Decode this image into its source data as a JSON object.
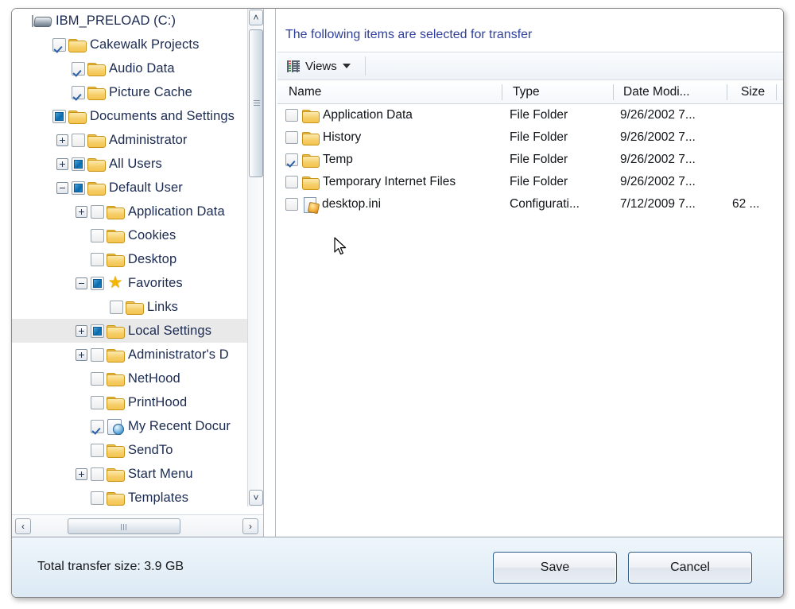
{
  "caption": "The following items are selected for transfer",
  "toolbar": {
    "views_label": "Views",
    "views_icon": "views-list-icon",
    "caret_icon": "chevron-down-icon"
  },
  "tree": {
    "root_label": "IBM_PRELOAD (C:)",
    "root_icon": "drive-icon",
    "items": [
      {
        "label": "IBM_PRELOAD (C:)",
        "depth": 0,
        "icon": "drive-icon",
        "check": "none",
        "expander": "none",
        "selected": false
      },
      {
        "label": "Cakewalk Projects",
        "depth": 1,
        "icon": "folder-icon",
        "check": "checked",
        "expander": "none",
        "selected": false
      },
      {
        "label": "Audio Data",
        "depth": 2,
        "icon": "folder-icon",
        "check": "checked",
        "expander": "none",
        "selected": false
      },
      {
        "label": "Picture Cache",
        "depth": 2,
        "icon": "folder-icon",
        "check": "checked",
        "expander": "none",
        "selected": false
      },
      {
        "label": "Documents and Settings",
        "depth": 1,
        "icon": "folder-icon",
        "check": "partial",
        "expander": "none",
        "selected": false
      },
      {
        "label": "Administrator",
        "depth": 2,
        "icon": "folder-icon",
        "check": "unchecked",
        "expander": "plus",
        "selected": false
      },
      {
        "label": "All Users",
        "depth": 2,
        "icon": "folder-icon",
        "check": "partial",
        "expander": "plus",
        "selected": false
      },
      {
        "label": "Default User",
        "depth": 2,
        "icon": "folder-icon",
        "check": "partial",
        "expander": "minus",
        "selected": false
      },
      {
        "label": "Application Data",
        "depth": 3,
        "icon": "folder-icon",
        "check": "unchecked",
        "expander": "plus",
        "selected": false
      },
      {
        "label": "Cookies",
        "depth": 3,
        "icon": "folder-icon",
        "check": "unchecked",
        "expander": "none",
        "selected": false
      },
      {
        "label": "Desktop",
        "depth": 3,
        "icon": "folder-icon",
        "check": "unchecked",
        "expander": "none",
        "selected": false
      },
      {
        "label": "Favorites",
        "depth": 3,
        "icon": "star-icon",
        "check": "partial",
        "expander": "minus",
        "selected": false
      },
      {
        "label": "Links",
        "depth": 4,
        "icon": "folder-icon",
        "check": "unchecked",
        "expander": "none",
        "selected": false
      },
      {
        "label": "Local Settings",
        "depth": 3,
        "icon": "folder-icon",
        "check": "partial",
        "expander": "plus",
        "selected": true
      },
      {
        "label": "Administrator's D",
        "depth": 3,
        "icon": "folder-icon",
        "check": "unchecked",
        "expander": "plus",
        "selected": false
      },
      {
        "label": "NetHood",
        "depth": 3,
        "icon": "folder-icon",
        "check": "unchecked",
        "expander": "none",
        "selected": false
      },
      {
        "label": "PrintHood",
        "depth": 3,
        "icon": "folder-icon",
        "check": "unchecked",
        "expander": "none",
        "selected": false
      },
      {
        "label": "My Recent Docur",
        "depth": 3,
        "icon": "recent-documents-icon",
        "check": "checked",
        "expander": "none",
        "selected": false
      },
      {
        "label": "SendTo",
        "depth": 3,
        "icon": "folder-icon",
        "check": "unchecked",
        "expander": "none",
        "selected": false
      },
      {
        "label": "Start Menu",
        "depth": 3,
        "icon": "folder-icon",
        "check": "unchecked",
        "expander": "plus",
        "selected": false
      },
      {
        "label": "Templates",
        "depth": 3,
        "icon": "folder-icon",
        "check": "unchecked",
        "expander": "none",
        "selected": false
      }
    ]
  },
  "list": {
    "columns": [
      "Name",
      "Type",
      "Date Modi...",
      "Size"
    ],
    "rows": [
      {
        "name": "Application Data",
        "type": "File Folder",
        "date": "9/26/2002 7...",
        "size": "",
        "checked": false,
        "icon": "folder-icon"
      },
      {
        "name": "History",
        "type": "File Folder",
        "date": "9/26/2002 7...",
        "size": "",
        "checked": false,
        "icon": "folder-icon"
      },
      {
        "name": "Temp",
        "type": "File Folder",
        "date": "9/26/2002 7...",
        "size": "",
        "checked": true,
        "icon": "folder-icon"
      },
      {
        "name": "Temporary Internet Files",
        "type": "File Folder",
        "date": "9/26/2002 7...",
        "size": "",
        "checked": false,
        "icon": "folder-icon"
      },
      {
        "name": "desktop.ini",
        "type": "Configurati...",
        "date": "7/12/2009 7...",
        "size": "62 ...",
        "checked": false,
        "icon": "ini-file-icon"
      }
    ]
  },
  "footer": {
    "total_size_label": "Total transfer size: 3.9 GB",
    "save_label": "Save",
    "cancel_label": "Cancel"
  },
  "scrollbars": {
    "v_up_glyph": "˄",
    "v_down_glyph": "˅",
    "h_left_glyph": "‹",
    "h_right_glyph": "›"
  },
  "colors": {
    "caption_blue": "#2f3f9e",
    "selection_gray": "#e9e9ea",
    "footer_blue": "#e4eff7",
    "button_border": "#2f5a86"
  }
}
